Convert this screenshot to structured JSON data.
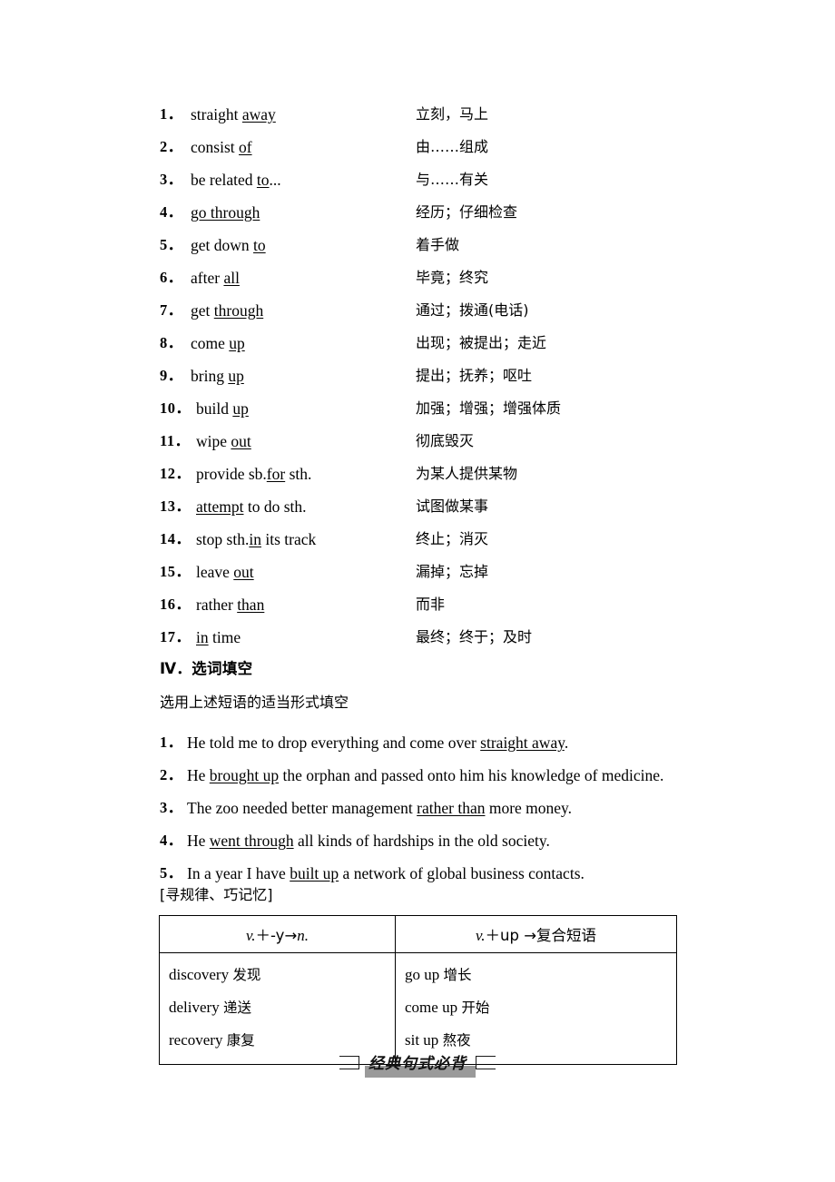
{
  "phrases": {
    "items": [
      {
        "num": "1．",
        "en_pre": "straight ",
        "en_ul": "away",
        "en_post": "",
        "cn": "立刻，马上"
      },
      {
        "num": "2．",
        "en_pre": "consist ",
        "en_ul": "of",
        "en_post": "",
        "cn": "由……组成"
      },
      {
        "num": "3．",
        "en_pre": "be related ",
        "en_ul": "to",
        "en_post": "...",
        "cn": "与……有关"
      },
      {
        "num": "4．",
        "en_pre": "",
        "en_ul": "go through",
        "en_post": "",
        "cn": "经历；仔细检查"
      },
      {
        "num": "5．",
        "en_pre": "get down ",
        "en_ul": "to",
        "en_post": "",
        "cn": "着手做"
      },
      {
        "num": "6．",
        "en_pre": "after ",
        "en_ul": "all",
        "en_post": "",
        "cn": "毕竟；终究"
      },
      {
        "num": "7．",
        "en_pre": "get ",
        "en_ul": "through",
        "en_post": "",
        "cn": "通过；拨通(电话)"
      },
      {
        "num": "8．",
        "en_pre": "come ",
        "en_ul": "up",
        "en_post": "",
        "cn": "出现；被提出；走近"
      },
      {
        "num": "9．",
        "en_pre": "bring ",
        "en_ul": "up",
        "en_post": "",
        "cn": "提出；抚养；呕吐"
      },
      {
        "num": "10．",
        "en_pre": "build ",
        "en_ul": "up",
        "en_post": "",
        "cn": "加强；增强；增强体质"
      },
      {
        "num": "11．",
        "en_pre": "wipe ",
        "en_ul": "out",
        "en_post": "",
        "cn": "彻底毁灭"
      },
      {
        "num": "12．",
        "en_pre": "provide sb.",
        "en_ul": "for",
        "en_post": " sth.",
        "cn": "为某人提供某物"
      },
      {
        "num": "13．",
        "en_pre": "",
        "en_ul": "attempt",
        "en_post": " to do sth.",
        "cn": "试图做某事"
      },
      {
        "num": "14．",
        "en_pre": "stop sth.",
        "en_ul": "in",
        "en_post": " its track",
        "cn": "终止；消灭"
      },
      {
        "num": "15．",
        "en_pre": "leave ",
        "en_ul": "out",
        "en_post": "",
        "cn": "漏掉；忘掉"
      },
      {
        "num": "16．",
        "en_pre": "rather ",
        "en_ul": "than",
        "en_post": "",
        "cn": "而非"
      },
      {
        "num": "17．",
        "en_pre": "",
        "en_ul": "in",
        "en_post": " time",
        "cn": "最终；终于；及时"
      }
    ]
  },
  "section": {
    "heading": "Ⅳ．选词填空",
    "subheading": "选用上述短语的适当形式填空"
  },
  "exercises": {
    "items": [
      {
        "num": "1．",
        "pre": "He told me to drop everything and come over ",
        "ul": "straight away",
        "post": "."
      },
      {
        "num": "2．",
        "pre": "He ",
        "ul": "brought up",
        "post": " the orphan and passed onto him his knowledge of medicine."
      },
      {
        "num": "3．",
        "pre": "The zoo needed better management ",
        "ul": "rather than",
        "post": " more money."
      },
      {
        "num": "4．",
        "pre": "He ",
        "ul": "went through",
        "post": " all kinds of hardships in the old society."
      },
      {
        "num": "5．",
        "pre": "In a year I have ",
        "ul": "built up",
        "post": " a network of global business contacts."
      }
    ]
  },
  "tip": {
    "label": "[寻规律、巧记忆]"
  },
  "rules_table": {
    "headers": {
      "left_italic_1": "v.",
      "left_plain": "＋-y→",
      "left_italic_2": "n.",
      "right_italic": "v.",
      "right_plain": "＋up →复合短语"
    },
    "left_column": [
      {
        "en": "discovery",
        "cn": "发现"
      },
      {
        "en": "delivery",
        "cn": "递送"
      },
      {
        "en": "recovery",
        "cn": "康复"
      }
    ],
    "right_column": [
      {
        "en": "go up",
        "cn": "增长"
      },
      {
        "en": "come up",
        "cn": "开始"
      },
      {
        "en": "sit up",
        "cn": "熬夜"
      }
    ]
  },
  "banner": {
    "title": "经典句式必背"
  }
}
